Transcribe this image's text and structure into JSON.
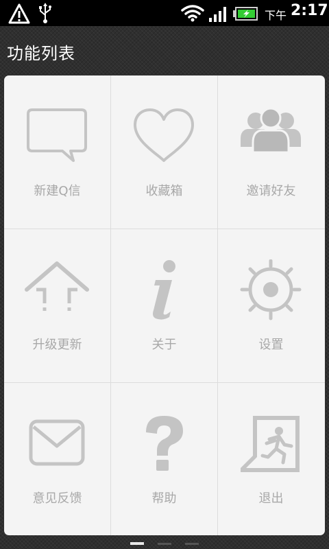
{
  "status_bar": {
    "ampm": "下午",
    "time": "2:17",
    "icons": [
      "warning-icon",
      "usb-icon",
      "wifi-icon",
      "signal-icon",
      "battery-charging-icon"
    ]
  },
  "title_bar": {
    "title": "功能列表"
  },
  "grid": {
    "items": [
      {
        "label": "新建Q信",
        "icon": "chat-bubble-icon"
      },
      {
        "label": "收藏箱",
        "icon": "heart-icon"
      },
      {
        "label": "邀请好友",
        "icon": "people-icon"
      },
      {
        "label": "升级更新",
        "icon": "upgrade-arrow-icon"
      },
      {
        "label": "关于",
        "icon": "info-icon"
      },
      {
        "label": "设置",
        "icon": "gear-icon"
      },
      {
        "label": "意见反馈",
        "icon": "envelope-icon"
      },
      {
        "label": "帮助",
        "icon": "question-icon"
      },
      {
        "label": "退出",
        "icon": "exit-door-icon"
      }
    ]
  },
  "page_indicator": {
    "pages": 3,
    "current": 1
  },
  "colors": {
    "card_background": "#f4f4f4",
    "icon_stroke": "#c4c4c4",
    "label_text": "#a8a8a8",
    "status_bar_background": "#000000",
    "battery_green": "#33cc33"
  }
}
